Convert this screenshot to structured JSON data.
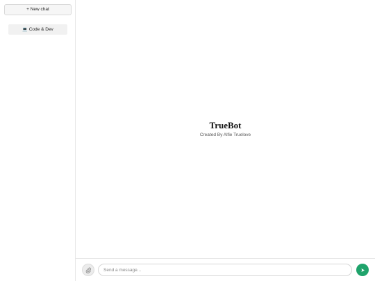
{
  "sidebar": {
    "new_chat_label": "+ New chat",
    "categories": [
      {
        "emoji": "💻",
        "label": "Code & Dev"
      }
    ]
  },
  "welcome": {
    "title": "TrueBot",
    "subtitle": "Created By Alfie Truelove"
  },
  "composer": {
    "placeholder": "Send a message...",
    "value": "",
    "attach_icon": "paperclip-icon",
    "send_icon": "send-arrow-icon"
  },
  "colors": {
    "send_button": "#1fa36b",
    "sidebar_border": "#e6e6e6",
    "category_bg": "#f1f1f1"
  }
}
